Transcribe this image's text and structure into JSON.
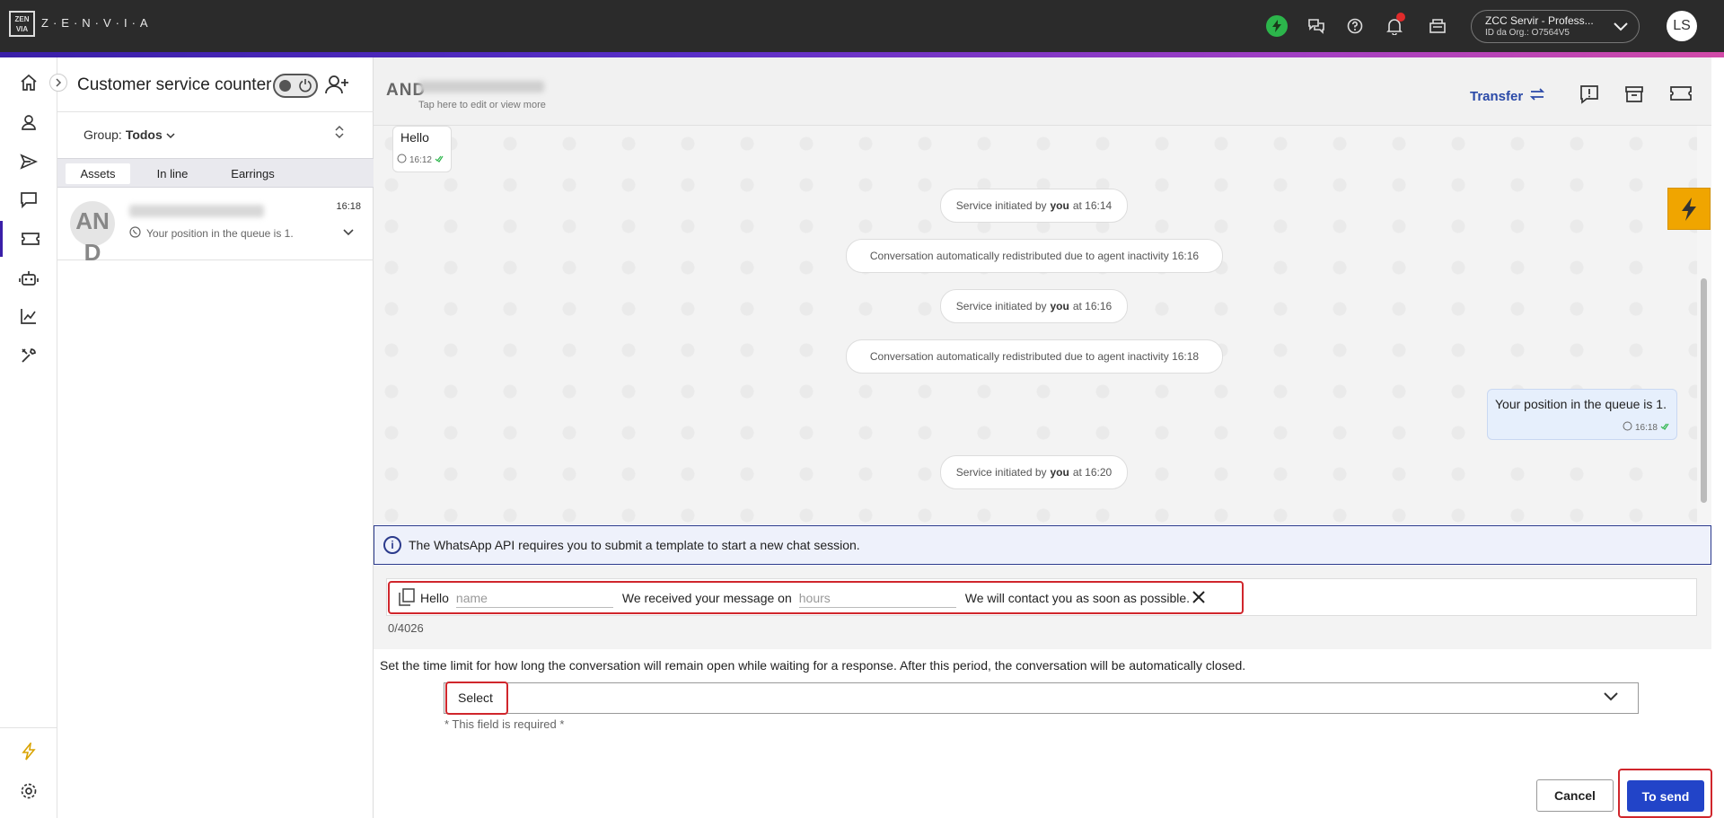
{
  "topbar": {
    "logo_box_text": "ZEN VIA",
    "logo_text": "Z·E·N·V·I·A",
    "org_name": "ZCC Servir - Profess...",
    "org_id": "ID da Org.: O7564V5",
    "user_initials": "LS"
  },
  "nav": [
    "home",
    "contacts",
    "send",
    "chat",
    "tickets",
    "bot",
    "reports",
    "tools",
    "automation",
    "settings"
  ],
  "list_panel": {
    "title": "Customer service counter",
    "group_label": "Group:",
    "group_value": "Todos",
    "tabs": [
      "Assets",
      "In line",
      "Earrings"
    ],
    "conversation": {
      "avatar_initials": "AN D",
      "time": "16:18",
      "last_message": "Your position in the queue is 1."
    }
  },
  "chat_header": {
    "avatar_initials": "AND",
    "hint": "Tap here to edit or view more",
    "transfer_label": "Transfer"
  },
  "messages": {
    "incoming": {
      "text": "Hello",
      "time": "16:12"
    },
    "system": [
      {
        "prefix": "Service initiated by",
        "bold": "you",
        "suffix": "at 16:14"
      },
      {
        "text": "Conversation automatically redistributed due to agent inactivity 16:16"
      },
      {
        "prefix": "Service initiated by",
        "bold": "you",
        "suffix": "at 16:16"
      },
      {
        "text": "Conversation automatically redistributed due to agent inactivity 16:18"
      },
      {
        "prefix": "Service initiated by",
        "bold": "you",
        "suffix": "at 16:20"
      }
    ],
    "outgoing": {
      "text": "Your position in the queue is 1.",
      "time": "16:18"
    }
  },
  "info_banner": "The WhatsApp API requires you to submit a template to start a new chat session.",
  "template": {
    "hello": "Hello",
    "name_placeholder": "name",
    "received": "We received your message on",
    "hours_placeholder": "hours",
    "contact": "We will contact you as soon as possible.",
    "char_count": "0/4026"
  },
  "time_limit": {
    "label": "Set the time limit for how long the conversation will remain open while waiting for a response. After this period, the conversation will be automatically closed.",
    "select_value": "Select",
    "required": "* This field is required *"
  },
  "buttons": {
    "cancel": "Cancel",
    "send": "To send"
  },
  "colors": {
    "accent": "#2244c8",
    "highlight": "#d0262c",
    "status_green": "#2cb54b",
    "quick_reply": "#f0a500"
  }
}
